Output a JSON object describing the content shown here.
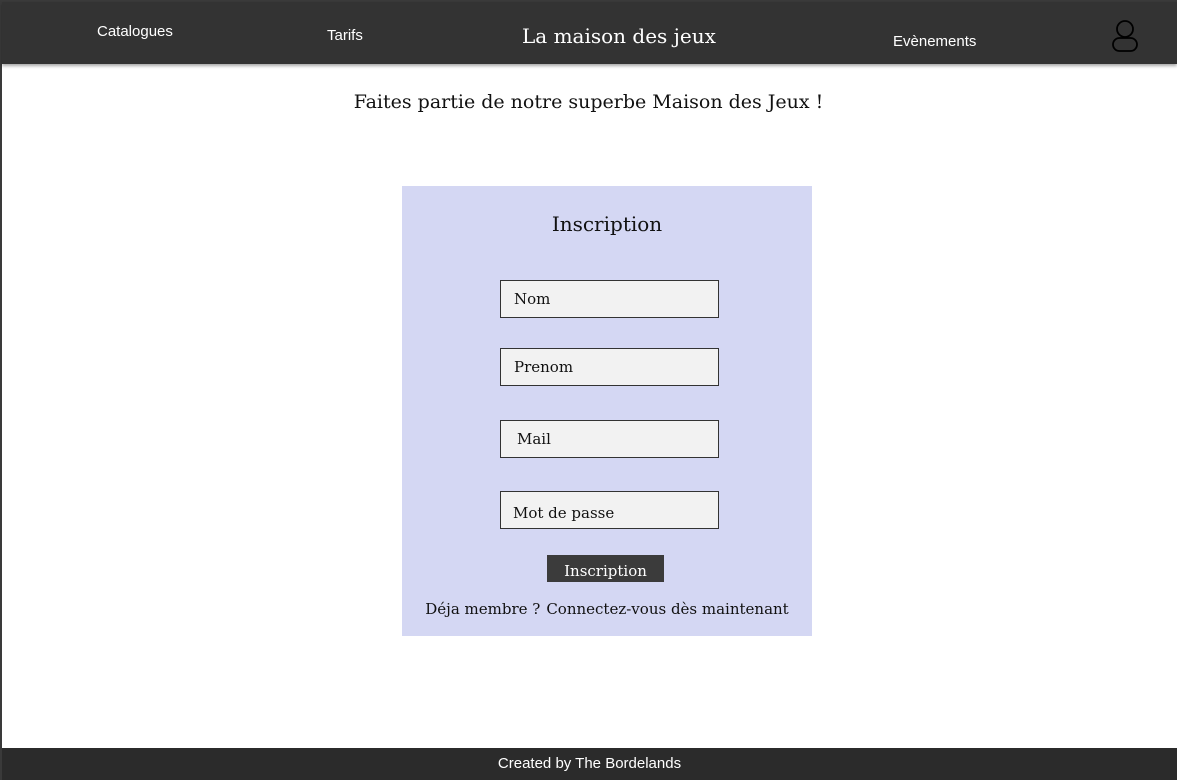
{
  "navbar": {
    "catalogues": "Catalogues",
    "tarifs": "Tarifs",
    "site_title": "La maison des jeux",
    "evenements": "Evènements",
    "user_icon": "user-icon"
  },
  "tagline": "Faites partie de notre superbe Maison des Jeux !",
  "form": {
    "title": "Inscription",
    "fields": [
      {
        "placeholder": "Nom"
      },
      {
        "placeholder": "Prenom"
      },
      {
        "placeholder": "Mail"
      },
      {
        "placeholder": "Mot de passe"
      }
    ],
    "submit_label": "Inscription",
    "already_member": "Déja membre ?",
    "login_link": "Connectez-vous dès maintenant"
  },
  "footer": {
    "text": "Created by The Bordelands"
  },
  "colors": {
    "navbar_bg": "#333333",
    "card_bg": "#d4d7f3",
    "field_bg": "#f2f2f2",
    "button_bg": "#3b3b3b",
    "footer_bg": "#2b2b2b"
  }
}
